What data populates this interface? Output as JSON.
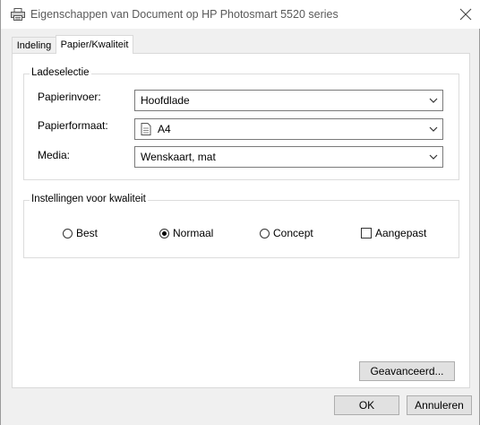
{
  "window": {
    "title": "Eigenschappen van Document op HP Photosmart 5520 series",
    "icon": "printer-icon",
    "close_icon": "close-icon"
  },
  "tabs": [
    {
      "label": "Indeling",
      "active": false
    },
    {
      "label": "Papier/Kwaliteit",
      "active": true
    }
  ],
  "tray": {
    "group_label": "Ladeselectie",
    "paper_source_label": "Papierinvoer:",
    "paper_source_value": "Hoofdlade",
    "paper_size_label": "Papierformaat:",
    "paper_size_value": "A4",
    "media_label": "Media:",
    "media_value": "Wenskaart, mat"
  },
  "quality": {
    "group_label": "Instellingen voor kwaliteit",
    "options": [
      {
        "label": "Best",
        "type": "radio",
        "selected": false
      },
      {
        "label": "Normaal",
        "type": "radio",
        "selected": true
      },
      {
        "label": "Concept",
        "type": "radio",
        "selected": false
      },
      {
        "label": "Aangepast",
        "type": "checkbox",
        "checked": false
      }
    ]
  },
  "buttons": {
    "advanced": "Geavanceerd...",
    "ok": "OK",
    "cancel": "Annuleren"
  }
}
